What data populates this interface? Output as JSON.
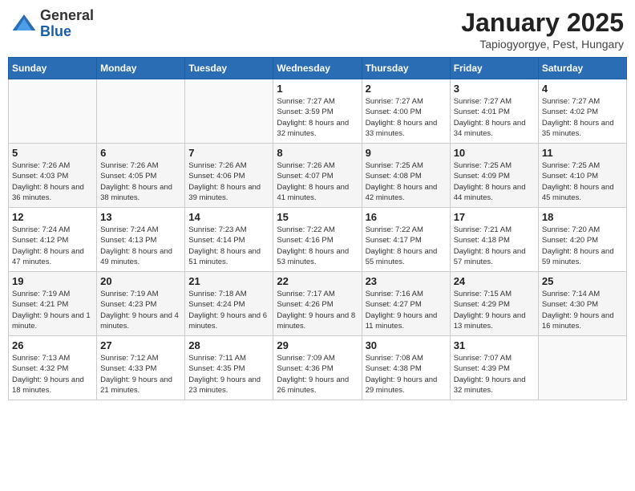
{
  "logo": {
    "general": "General",
    "blue": "Blue"
  },
  "title": "January 2025",
  "subtitle": "Tapiogyorgye, Pest, Hungary",
  "headers": [
    "Sunday",
    "Monday",
    "Tuesday",
    "Wednesday",
    "Thursday",
    "Friday",
    "Saturday"
  ],
  "weeks": [
    [
      {
        "day": "",
        "info": ""
      },
      {
        "day": "",
        "info": ""
      },
      {
        "day": "",
        "info": ""
      },
      {
        "day": "1",
        "info": "Sunrise: 7:27 AM\nSunset: 3:59 PM\nDaylight: 8 hours and 32 minutes."
      },
      {
        "day": "2",
        "info": "Sunrise: 7:27 AM\nSunset: 4:00 PM\nDaylight: 8 hours and 33 minutes."
      },
      {
        "day": "3",
        "info": "Sunrise: 7:27 AM\nSunset: 4:01 PM\nDaylight: 8 hours and 34 minutes."
      },
      {
        "day": "4",
        "info": "Sunrise: 7:27 AM\nSunset: 4:02 PM\nDaylight: 8 hours and 35 minutes."
      }
    ],
    [
      {
        "day": "5",
        "info": "Sunrise: 7:26 AM\nSunset: 4:03 PM\nDaylight: 8 hours and 36 minutes."
      },
      {
        "day": "6",
        "info": "Sunrise: 7:26 AM\nSunset: 4:05 PM\nDaylight: 8 hours and 38 minutes."
      },
      {
        "day": "7",
        "info": "Sunrise: 7:26 AM\nSunset: 4:06 PM\nDaylight: 8 hours and 39 minutes."
      },
      {
        "day": "8",
        "info": "Sunrise: 7:26 AM\nSunset: 4:07 PM\nDaylight: 8 hours and 41 minutes."
      },
      {
        "day": "9",
        "info": "Sunrise: 7:25 AM\nSunset: 4:08 PM\nDaylight: 8 hours and 42 minutes."
      },
      {
        "day": "10",
        "info": "Sunrise: 7:25 AM\nSunset: 4:09 PM\nDaylight: 8 hours and 44 minutes."
      },
      {
        "day": "11",
        "info": "Sunrise: 7:25 AM\nSunset: 4:10 PM\nDaylight: 8 hours and 45 minutes."
      }
    ],
    [
      {
        "day": "12",
        "info": "Sunrise: 7:24 AM\nSunset: 4:12 PM\nDaylight: 8 hours and 47 minutes."
      },
      {
        "day": "13",
        "info": "Sunrise: 7:24 AM\nSunset: 4:13 PM\nDaylight: 8 hours and 49 minutes."
      },
      {
        "day": "14",
        "info": "Sunrise: 7:23 AM\nSunset: 4:14 PM\nDaylight: 8 hours and 51 minutes."
      },
      {
        "day": "15",
        "info": "Sunrise: 7:22 AM\nSunset: 4:16 PM\nDaylight: 8 hours and 53 minutes."
      },
      {
        "day": "16",
        "info": "Sunrise: 7:22 AM\nSunset: 4:17 PM\nDaylight: 8 hours and 55 minutes."
      },
      {
        "day": "17",
        "info": "Sunrise: 7:21 AM\nSunset: 4:18 PM\nDaylight: 8 hours and 57 minutes."
      },
      {
        "day": "18",
        "info": "Sunrise: 7:20 AM\nSunset: 4:20 PM\nDaylight: 8 hours and 59 minutes."
      }
    ],
    [
      {
        "day": "19",
        "info": "Sunrise: 7:19 AM\nSunset: 4:21 PM\nDaylight: 9 hours and 1 minute."
      },
      {
        "day": "20",
        "info": "Sunrise: 7:19 AM\nSunset: 4:23 PM\nDaylight: 9 hours and 4 minutes."
      },
      {
        "day": "21",
        "info": "Sunrise: 7:18 AM\nSunset: 4:24 PM\nDaylight: 9 hours and 6 minutes."
      },
      {
        "day": "22",
        "info": "Sunrise: 7:17 AM\nSunset: 4:26 PM\nDaylight: 9 hours and 8 minutes."
      },
      {
        "day": "23",
        "info": "Sunrise: 7:16 AM\nSunset: 4:27 PM\nDaylight: 9 hours and 11 minutes."
      },
      {
        "day": "24",
        "info": "Sunrise: 7:15 AM\nSunset: 4:29 PM\nDaylight: 9 hours and 13 minutes."
      },
      {
        "day": "25",
        "info": "Sunrise: 7:14 AM\nSunset: 4:30 PM\nDaylight: 9 hours and 16 minutes."
      }
    ],
    [
      {
        "day": "26",
        "info": "Sunrise: 7:13 AM\nSunset: 4:32 PM\nDaylight: 9 hours and 18 minutes."
      },
      {
        "day": "27",
        "info": "Sunrise: 7:12 AM\nSunset: 4:33 PM\nDaylight: 9 hours and 21 minutes."
      },
      {
        "day": "28",
        "info": "Sunrise: 7:11 AM\nSunset: 4:35 PM\nDaylight: 9 hours and 23 minutes."
      },
      {
        "day": "29",
        "info": "Sunrise: 7:09 AM\nSunset: 4:36 PM\nDaylight: 9 hours and 26 minutes."
      },
      {
        "day": "30",
        "info": "Sunrise: 7:08 AM\nSunset: 4:38 PM\nDaylight: 9 hours and 29 minutes."
      },
      {
        "day": "31",
        "info": "Sunrise: 7:07 AM\nSunset: 4:39 PM\nDaylight: 9 hours and 32 minutes."
      },
      {
        "day": "",
        "info": ""
      }
    ]
  ]
}
